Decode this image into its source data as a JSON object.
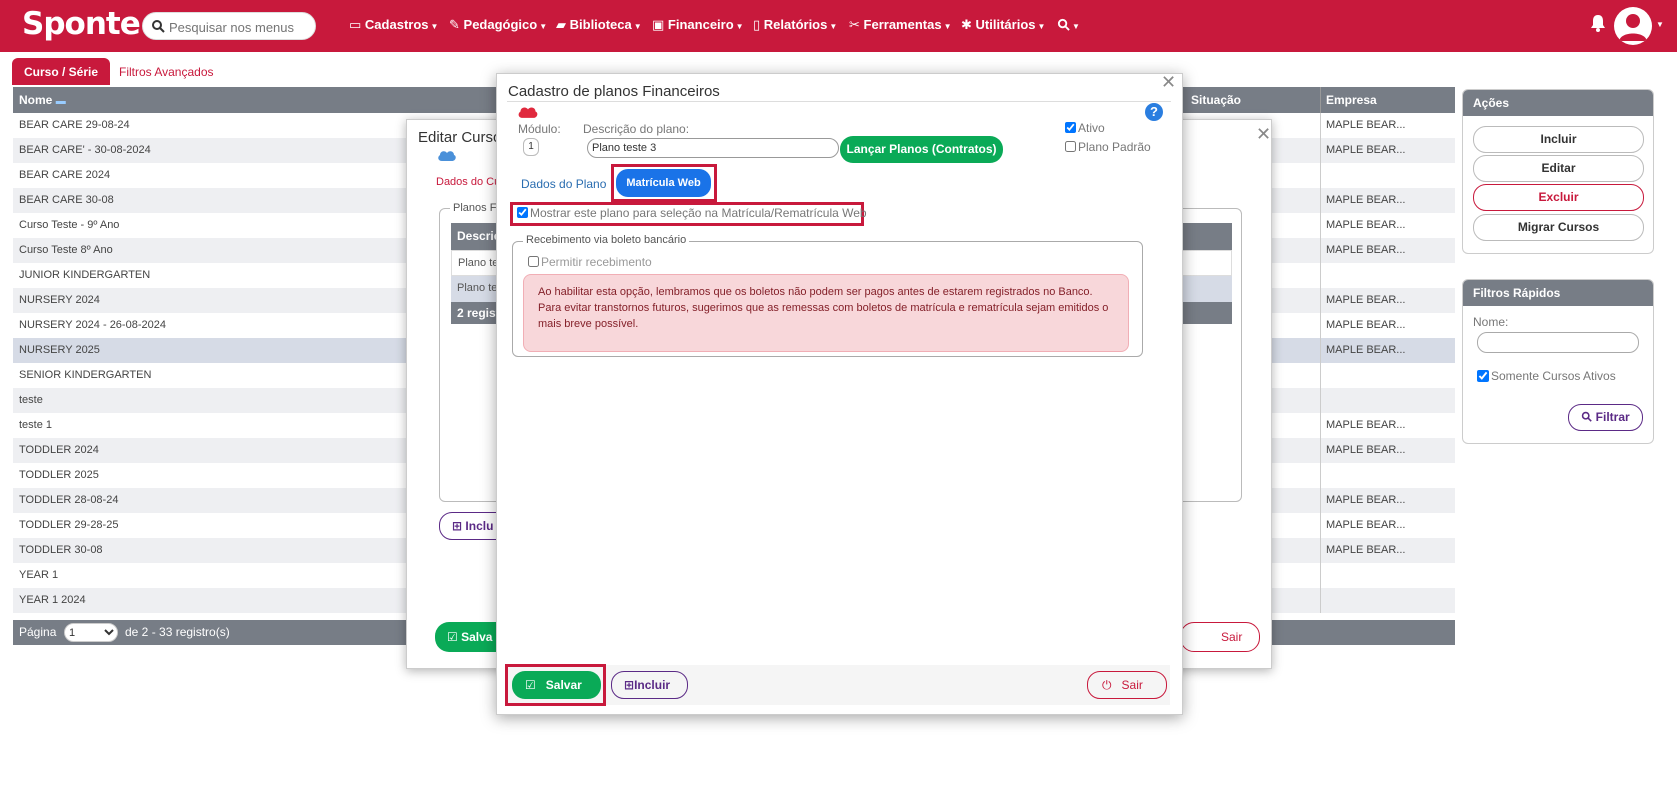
{
  "app": {
    "logo": "Sponte"
  },
  "search": {
    "placeholder": "Pesquisar nos menus"
  },
  "nav": [
    {
      "label": "Cadastros",
      "icon": "card-icon"
    },
    {
      "label": "Pedagógico",
      "icon": "edit-icon"
    },
    {
      "label": "Biblioteca",
      "icon": "book-icon"
    },
    {
      "label": "Financeiro",
      "icon": "money-icon"
    },
    {
      "label": "Relatórios",
      "icon": "file-icon"
    },
    {
      "label": "Ferramentas",
      "icon": "wrench-icon"
    },
    {
      "label": "Utilitários",
      "icon": "gear-icon"
    }
  ],
  "tabs": {
    "curso": "Curso / Série",
    "filtros": "Filtros Avançados"
  },
  "table": {
    "headers": {
      "nome": "Nome",
      "situacao": "Situação",
      "empresa": "Empresa"
    },
    "rows": [
      {
        "nome": "BEAR CARE 29-08-24",
        "empresa": "MAPLE BEAR..."
      },
      {
        "nome": "BEAR CARE' - 30-08-2024",
        "empresa": "MAPLE BEAR..."
      },
      {
        "nome": "BEAR CARE 2024",
        "empresa": ""
      },
      {
        "nome": "BEAR CARE 30-08",
        "empresa": "MAPLE BEAR..."
      },
      {
        "nome": "Curso Teste - 9º Ano",
        "empresa": "MAPLE BEAR..."
      },
      {
        "nome": "Curso Teste 8º Ano",
        "empresa": "MAPLE BEAR..."
      },
      {
        "nome": "JUNIOR KINDERGARTEN",
        "empresa": ""
      },
      {
        "nome": "NURSERY 2024",
        "empresa": "MAPLE BEAR..."
      },
      {
        "nome": "NURSERY 2024 - 26-08-2024",
        "empresa": "MAPLE BEAR..."
      },
      {
        "nome": "NURSERY 2025",
        "empresa": "MAPLE BEAR..."
      },
      {
        "nome": "SENIOR KINDERGARTEN",
        "empresa": ""
      },
      {
        "nome": "teste",
        "empresa": ""
      },
      {
        "nome": "teste 1",
        "empresa": "MAPLE BEAR..."
      },
      {
        "nome": "TODDLER 2024",
        "empresa": "MAPLE BEAR..."
      },
      {
        "nome": "TODDLER 2025",
        "empresa": ""
      },
      {
        "nome": "TODDLER 28-08-24",
        "empresa": "MAPLE BEAR..."
      },
      {
        "nome": "TODDLER 29-28-25",
        "empresa": "MAPLE BEAR..."
      },
      {
        "nome": "TODDLER 30-08",
        "empresa": "MAPLE BEAR..."
      },
      {
        "nome": "YEAR 1",
        "empresa": ""
      },
      {
        "nome": "YEAR 1 2024",
        "empresa": ""
      }
    ],
    "pager": {
      "label": "Página",
      "page": "1",
      "info": "de 2 - 33 registro(s)"
    }
  },
  "acoes": {
    "title": "Ações",
    "incluir": "Incluir",
    "editar": "Editar",
    "excluir": "Excluir",
    "migrar": "Migrar Cursos"
  },
  "filtros_rapidos": {
    "title": "Filtros Rápidos",
    "nome_label": "Nome:",
    "somente_ativos": "Somente Cursos Ativos",
    "filtrar": "Filtrar"
  },
  "dialog_bg": {
    "title": "Editar Curso",
    "tab": "Dados do Cu",
    "group": "Planos Fi",
    "col": "Descriç",
    "row1": "Plano te",
    "row2": "Plano te",
    "footer": "2 regist",
    "incluir": "Inclu",
    "salvar": "Salva",
    "sair": "Sair"
  },
  "dialog": {
    "title": "Cadastro de planos Financeiros",
    "modulo_label": "Módulo:",
    "modulo_value": "1",
    "descricao_label": "Descrição do plano:",
    "descricao_value": "Plano teste 3",
    "lancar": "Lançar Planos (Contratos)",
    "ativo": "Ativo",
    "plano_padrao": "Plano Padrão",
    "tab_dados": "Dados do Plano",
    "tab_matricula": "Matrícula Web",
    "mostrar": "Mostrar este plano para seleção na Matrícula/Rematrícula Web",
    "fieldset": "Recebimento via boleto bancário",
    "permitir": "Permitir recebimento",
    "alert": "Ao habilitar esta opção, lembramos que os boletos não podem ser pagos antes de estarem registrados no Banco. Para evitar transtornos futuros, sugerimos que as remessas com boletos de matrícula e rematrícula sejam emitidos o mais breve possível.",
    "salvar": "Salvar",
    "incluir": "Incluir",
    "sair": "Sair"
  },
  "colors": {
    "brand": "#c8193c",
    "success": "#0aaa57",
    "primary": "#1a73e8",
    "purple": "#5b2a86"
  }
}
